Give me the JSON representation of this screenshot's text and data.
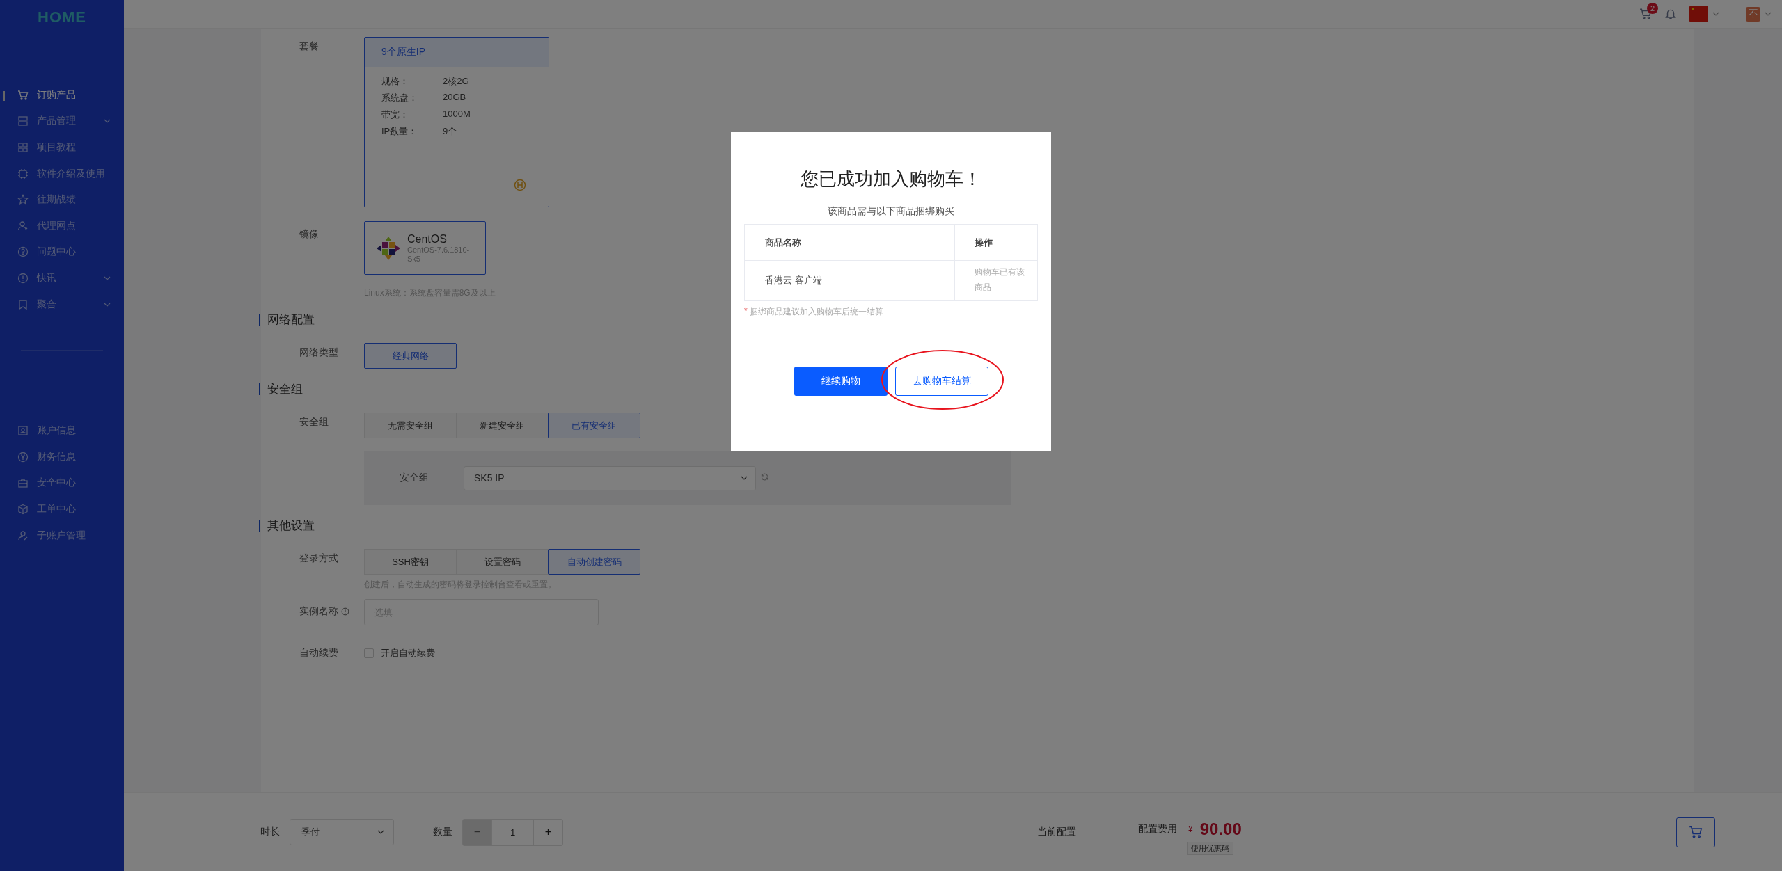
{
  "sidebar": {
    "logo": "HOME",
    "items": [
      {
        "label": "订购产品",
        "selected": true,
        "expandable": false
      },
      {
        "label": "产品管理",
        "selected": false,
        "expandable": true
      },
      {
        "label": "项目教程",
        "selected": false,
        "expandable": false
      },
      {
        "label": "软件介绍及使用",
        "selected": false,
        "expandable": false
      },
      {
        "label": "往期战绩",
        "selected": false,
        "expandable": false
      },
      {
        "label": "代理网点",
        "selected": false,
        "expandable": false
      },
      {
        "label": "问题中心",
        "selected": false,
        "expandable": false
      },
      {
        "label": "快讯",
        "selected": false,
        "expandable": true
      },
      {
        "label": "聚合",
        "selected": false,
        "expandable": true
      }
    ],
    "account_items": [
      {
        "label": "账户信息",
        "selected": false
      },
      {
        "label": "财务信息",
        "selected": false
      },
      {
        "label": "安全中心",
        "selected": false
      },
      {
        "label": "工单中心",
        "selected": false
      },
      {
        "label": "子账户管理",
        "selected": false
      }
    ]
  },
  "header": {
    "cart_count": "2",
    "avatar": "不"
  },
  "form": {
    "package": {
      "label": "套餐",
      "card": {
        "title": "9个原生IP",
        "selected": true,
        "specs": [
          {
            "name": "规格：",
            "value": "2核2G"
          },
          {
            "name": "系统盘：",
            "value": "20GB"
          },
          {
            "name": "带宽：",
            "value": "1000M"
          },
          {
            "name": "IP数量：",
            "value": "9个"
          }
        ]
      }
    },
    "image": {
      "label": "镜像",
      "card": {
        "name": "CentOS",
        "version": "CentOS-7.6.1810-Sk5",
        "selected": true
      },
      "hint": "Linux系统：系统盘容量需8G及以上"
    },
    "network": {
      "heading": "网络配置",
      "label": "网络类型",
      "options": [
        {
          "label": "经典网络",
          "selected": true
        }
      ]
    },
    "security": {
      "heading": "安全组",
      "label": "安全组",
      "options": [
        {
          "label": "无需安全组",
          "selected": false
        },
        {
          "label": "新建安全组",
          "selected": false
        },
        {
          "label": "已有安全组",
          "selected": true
        }
      ],
      "panel": {
        "label": "安全组",
        "value": "SK5 IP"
      }
    },
    "other": {
      "heading": "其他设置",
      "login": {
        "label": "登录方式",
        "options": [
          {
            "label": "SSH密钥",
            "selected": false
          },
          {
            "label": "设置密码",
            "selected": false
          },
          {
            "label": "自动创建密码",
            "selected": true
          }
        ],
        "hint": "创建后，自动生成的密码将登录控制台查看或重置。"
      },
      "instance_name": {
        "label": "实例名称",
        "placeholder": "选填"
      },
      "auto_renew": {
        "label": "自动续费",
        "option": "开启自动续费",
        "checked": false
      }
    }
  },
  "footer": {
    "duration": {
      "label": "时长",
      "value": "季付"
    },
    "quantity": {
      "label": "数量",
      "minus": "−",
      "value": "1",
      "plus": "+",
      "minus_disabled": true
    },
    "current_config": "当前配置",
    "fee_label": "配置费用",
    "currency": "¥",
    "price": "90.00",
    "coupon": "使用优惠码"
  },
  "modal": {
    "title": "您已成功加入购物车！",
    "subtitle": "该商品需与以下商品捆绑购买",
    "columns": [
      "商品名称",
      "操作"
    ],
    "rows": [
      {
        "name": "香港云 客户端",
        "action": "购物车已有该商品"
      }
    ],
    "note_marker": "*",
    "note": "捆绑商品建议加入购物车后统一结算",
    "buttons": [
      {
        "label": "继续购物",
        "kind": "primary"
      },
      {
        "label": "去购物车结算",
        "kind": "secondary",
        "circled": true
      }
    ]
  }
}
